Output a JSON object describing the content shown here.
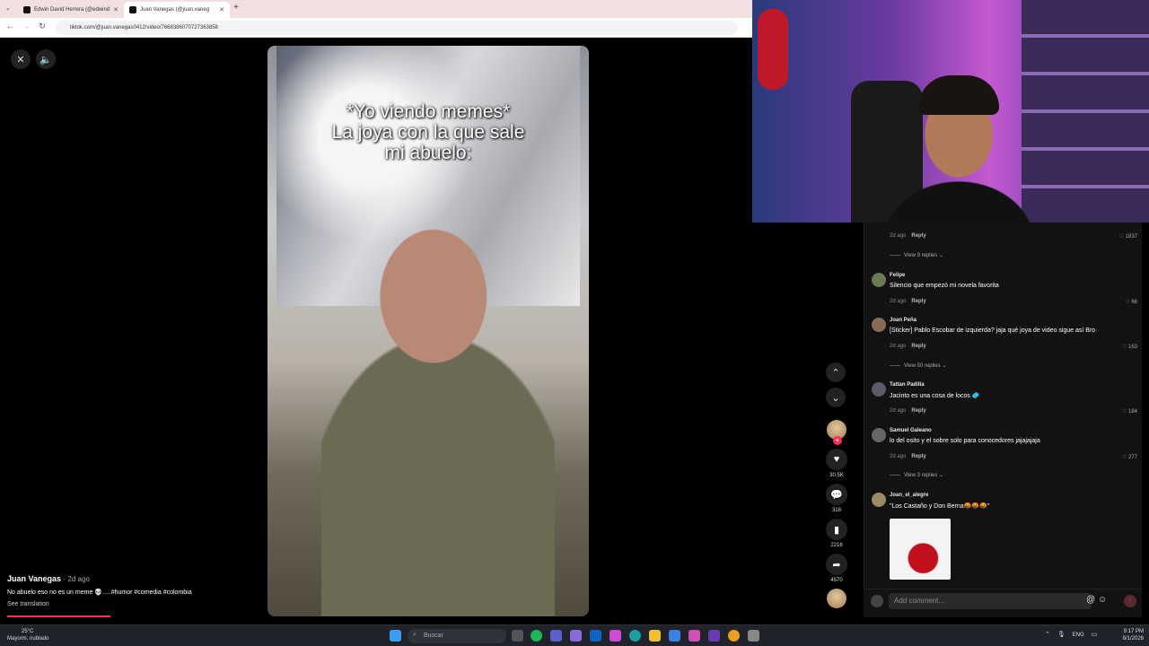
{
  "browser": {
    "tabs": [
      {
        "title": "Edwin David Herrera (@edwind",
        "active": false
      },
      {
        "title": "Juan Vanegas (@juan.vaneg",
        "active": true
      }
    ],
    "new_tab": "+",
    "url": "tiktok.com/@juan.vanegas0412/video/7668386070727363858"
  },
  "video": {
    "caption_lines": [
      "*Yo viendo memes*",
      "La joya con la que sale",
      "mi abuelo:"
    ],
    "author": "Juan Vanegas",
    "date": "· 2d ago",
    "description": "No abuelo eso no es un meme 💀.....#humor #comedia #colombia",
    "see_translation": "See translation",
    "progress": 0.25
  },
  "actions": {
    "likes": "30.5K",
    "comments": "318",
    "saves": "2216",
    "shares": "4570"
  },
  "comments": [
    {
      "type": "meta",
      "date": "2d ago",
      "reply": "Reply",
      "likes": "1837"
    },
    {
      "type": "replies",
      "label": "View 9 replies"
    },
    {
      "type": "comment",
      "user": "Felipe",
      "text": "Silencio que empezó mi novela favorita",
      "date": "2d ago",
      "reply": "Reply",
      "likes": "68"
    },
    {
      "type": "comment",
      "user": "Joan Peña",
      "text": "[Sticker] Pablo Escobar de izquierda? jaja qué joya de video sigue así Bro",
      "date": "2d ago",
      "reply": "Reply",
      "likes": "163"
    },
    {
      "type": "replies",
      "label": "View 50 replies"
    },
    {
      "type": "comment",
      "user": "Tattan Padilla",
      "text": "Jacinto es una cosa de locos 🥏",
      "date": "2d ago",
      "reply": "Reply",
      "likes": "184"
    },
    {
      "type": "comment",
      "user": "Samuel Galeano",
      "text": "lo del osito y el sobre solo para conocedores jajajajaja",
      "date": "2d ago",
      "reply": "Reply",
      "likes": "277"
    },
    {
      "type": "replies",
      "label": "View 3 replies"
    },
    {
      "type": "comment",
      "user": "Joan_el_alegre",
      "text": "\"Los Castaño y Don Berna🤬🤬🤬\""
    }
  ],
  "add_comment_placeholder": "Add comment...",
  "taskbar": {
    "temp": "25°C",
    "weather": "Mayorm. nublado",
    "search": "Buscar",
    "lang": "ENG",
    "time": "9:17 PM",
    "date": "8/1/2026"
  }
}
